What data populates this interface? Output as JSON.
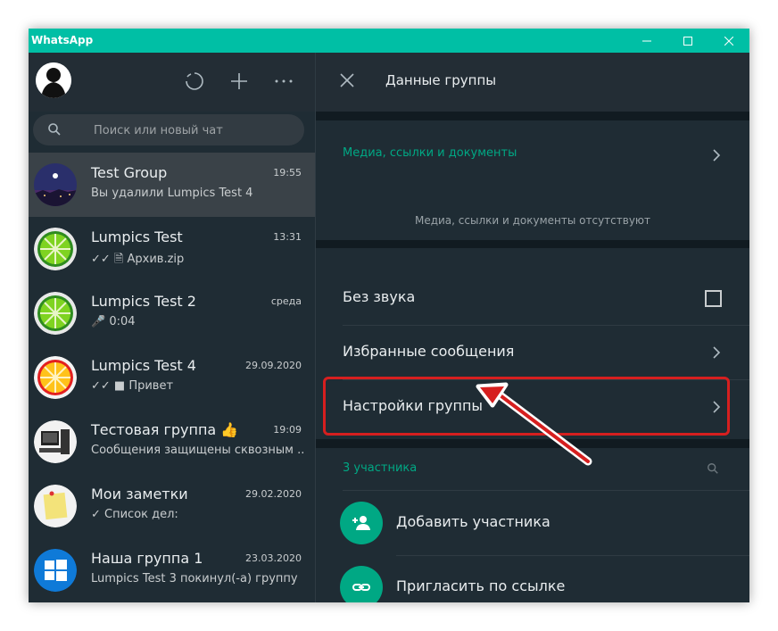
{
  "window": {
    "title": "WhatsApp"
  },
  "search": {
    "placeholder": "Поиск или новый чат"
  },
  "chats": [
    {
      "name": "Test Group",
      "time": "19:55",
      "last": "Вы удалили Lumpics Test 4"
    },
    {
      "name": "Lumpics Test",
      "time": "13:31",
      "last": "✓✓ 🗎 Архив.zip"
    },
    {
      "name": "Lumpics Test 2",
      "time": "среда",
      "last": "🎤 0:04"
    },
    {
      "name": "Lumpics Test 4",
      "time": "29.09.2020",
      "last": "✓✓ ■ Привет"
    },
    {
      "name": "Тестовая группа 👍",
      "time": "19:09",
      "last": "Сообщения защищены сквозным ..."
    },
    {
      "name": "Мои заметки",
      "time": "29.02.2020",
      "last": "✓ Список дел:"
    },
    {
      "name": "Наша группа 1",
      "time": "23.03.2020",
      "last": "Lumpics Test 3 покинул(-а) группу"
    }
  ],
  "group_info": {
    "title": "Данные группы",
    "media_title": "Медиа, ссылки и документы",
    "media_empty": "Медиа, ссылки и документы отсутствуют",
    "mute_label": "Без звука",
    "mute_checked": false,
    "starred_label": "Избранные сообщения",
    "settings_label": "Настройки группы",
    "members_count_label": "3 участника",
    "add_member_label": "Добавить участника",
    "invite_link_label": "Пригласить по ссылке"
  },
  "icons": {
    "accent": "#00a884",
    "titlebar_color": "#00bfa5",
    "highlight_color": "#d61f1f"
  }
}
